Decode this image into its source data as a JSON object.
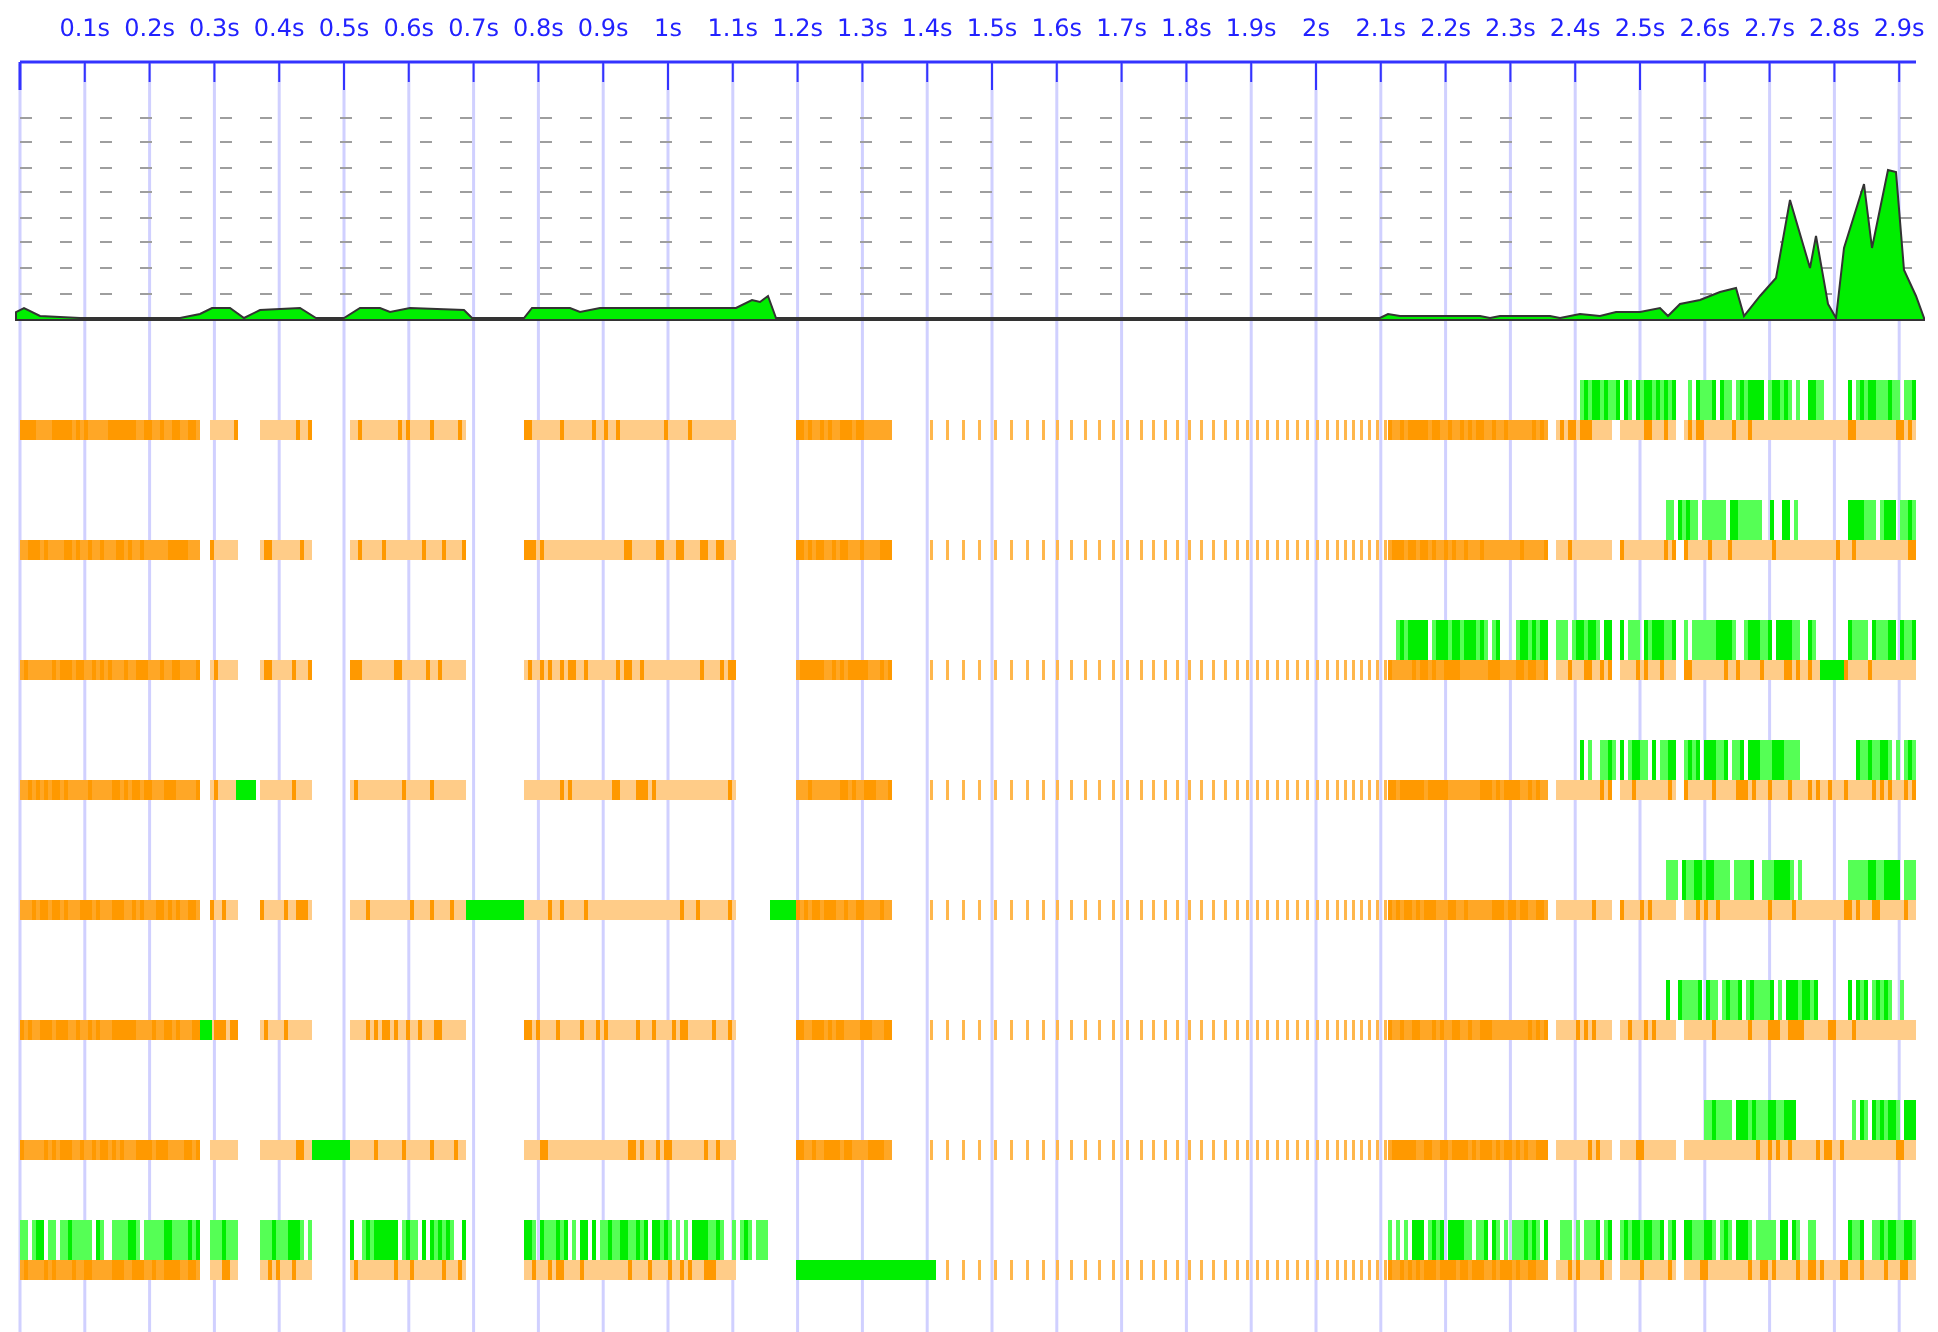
{
  "time_axis": {
    "ticks": [
      "0.1s",
      "0.2s",
      "0.3s",
      "0.4s",
      "0.5s",
      "0.6s",
      "0.7s",
      "0.8s",
      "0.9s",
      "1s",
      "1.1s",
      "1.2s",
      "1.3s",
      "1.4s",
      "1.5s",
      "1.6s",
      "1.7s",
      "1.8s",
      "1.9s",
      "2s",
      "2.1s",
      "2.2s",
      "2.3s",
      "2.4s",
      "2.5s",
      "2.6s",
      "2.7s",
      "2.8s",
      "2.9s"
    ]
  },
  "timelines": [
    {
      "kind": "hec"
    },
    {
      "kind": "hec"
    },
    {
      "kind": "hec"
    },
    {
      "kind": "hec"
    },
    {
      "kind": "hec"
    },
    {
      "kind": "hec"
    },
    {
      "kind": "hec"
    },
    {
      "kind": "hec"
    }
  ]
}
